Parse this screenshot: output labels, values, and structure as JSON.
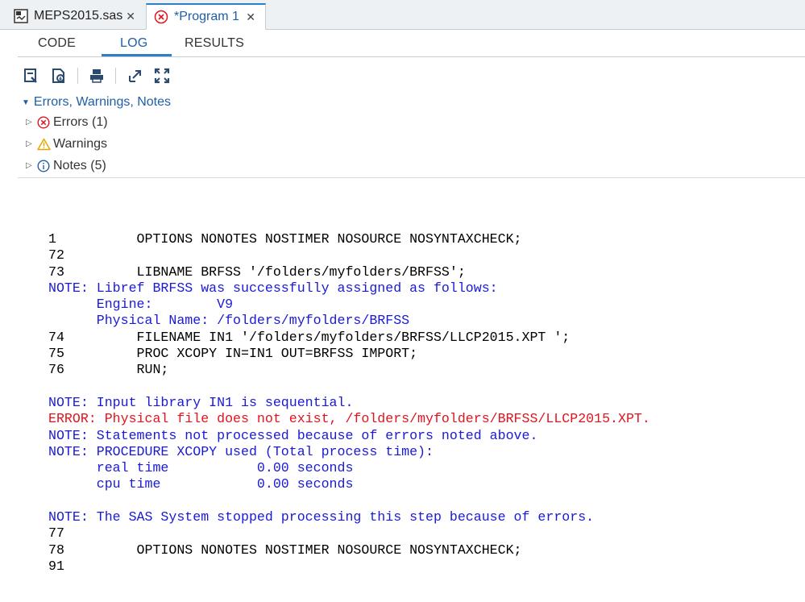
{
  "file_tabs": [
    {
      "label": "MEPS2015.sas",
      "icon": "sas-program-icon",
      "close": "✕"
    },
    {
      "label": "*Program 1",
      "icon": "error-circle-icon",
      "close": "✕"
    }
  ],
  "sub_tabs": {
    "code": "CODE",
    "log": "LOG",
    "results": "RESULTS",
    "active": "LOG"
  },
  "toolbar": [
    "export-log-icon",
    "download-log-icon",
    "print-icon",
    "popout-icon",
    "maximize-icon"
  ],
  "tree": {
    "header": "Errors, Warnings, Notes",
    "errors": "Errors (1)",
    "warnings": "Warnings",
    "notes": "Notes (5)"
  },
  "colors": {
    "note": "#1a1ad6",
    "error": "#e0141e",
    "accent": "#2a7fc6"
  },
  "log_lines": [
    {
      "text": "1          OPTIONS NONOTES NOSTIMER NOSOURCE NOSYNTAXCHECK;",
      "type": "code"
    },
    {
      "text": "72",
      "type": "code"
    },
    {
      "text": "73         LIBNAME BRFSS '/folders/myfolders/BRFSS';",
      "type": "code"
    },
    {
      "text": "NOTE: Libref BRFSS was successfully assigned as follows:",
      "type": "note"
    },
    {
      "text": "      Engine:        V9",
      "type": "note"
    },
    {
      "text": "      Physical Name: /folders/myfolders/BRFSS",
      "type": "note"
    },
    {
      "text": "74         FILENAME IN1 '/folders/myfolders/BRFSS/LLCP2015.XPT ';",
      "type": "code"
    },
    {
      "text": "75         PROC XCOPY IN=IN1 OUT=BRFSS IMPORT;",
      "type": "code"
    },
    {
      "text": "76         RUN;",
      "type": "code"
    },
    {
      "text": "",
      "type": "code"
    },
    {
      "text": "NOTE: Input library IN1 is sequential.",
      "type": "note"
    },
    {
      "text": "ERROR: Physical file does not exist, /folders/myfolders/BRFSS/LLCP2015.XPT.",
      "type": "err"
    },
    {
      "text": "NOTE: Statements not processed because of errors noted above.",
      "type": "note"
    },
    {
      "text": "NOTE: PROCEDURE XCOPY used (Total process time):",
      "type": "note"
    },
    {
      "text": "      real time           0.00 seconds",
      "type": "note"
    },
    {
      "text": "      cpu time            0.00 seconds",
      "type": "note"
    },
    {
      "text": "",
      "type": "code"
    },
    {
      "text": "NOTE: The SAS System stopped processing this step because of errors.",
      "type": "note"
    },
    {
      "text": "77",
      "type": "code"
    },
    {
      "text": "78         OPTIONS NONOTES NOSTIMER NOSOURCE NOSYNTAXCHECK;",
      "type": "code"
    },
    {
      "text": "91",
      "type": "code"
    }
  ]
}
